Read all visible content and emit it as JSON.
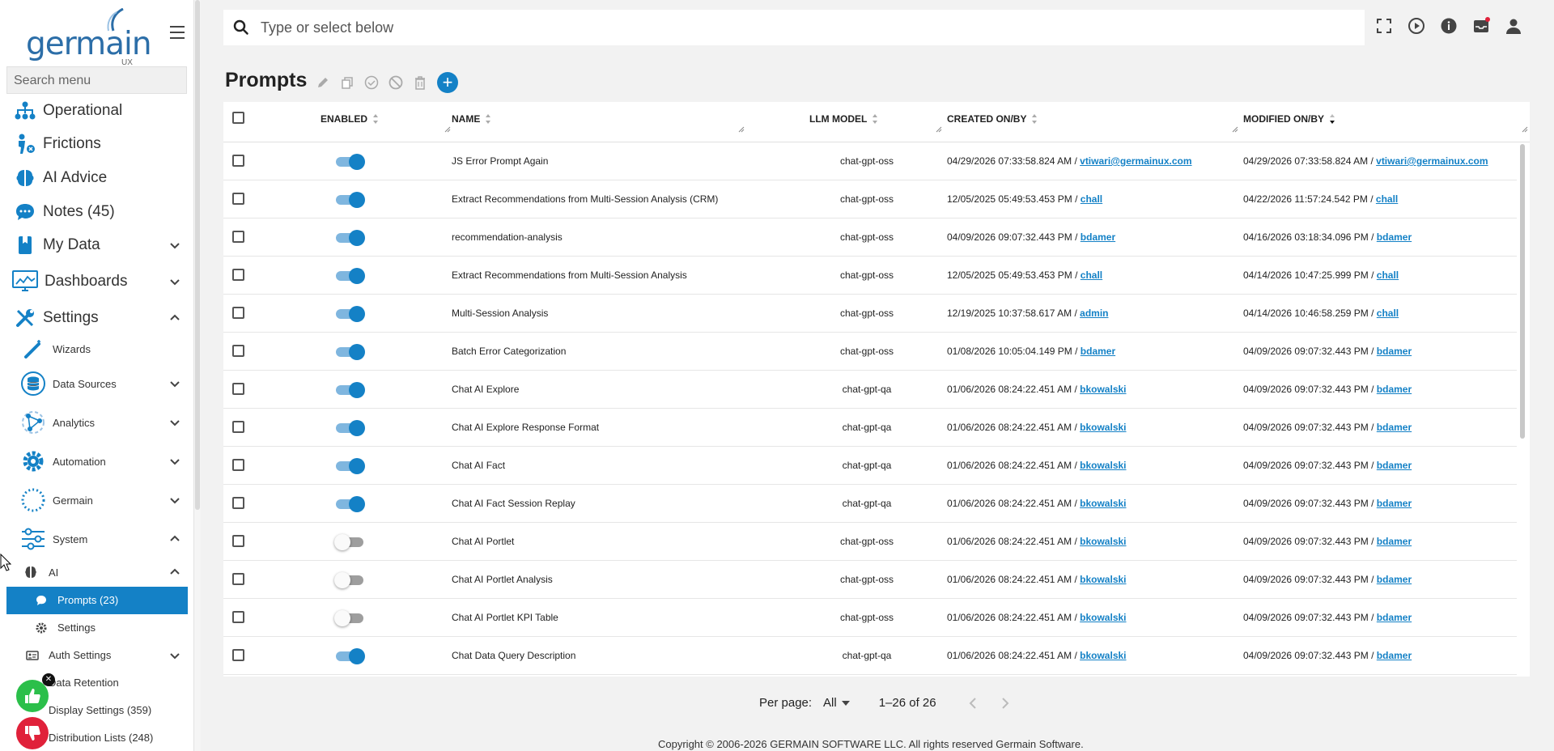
{
  "brand": {
    "name": "germain",
    "sub": "UX",
    "color": "#2c6ea8",
    "accent": "#1481c6"
  },
  "sidebar": {
    "search_placeholder": "Search menu",
    "items": [
      {
        "label": "Operational",
        "icon": "sitemap-icon"
      },
      {
        "label": "Frictions",
        "icon": "person-friction-icon"
      },
      {
        "label": "AI Advice",
        "icon": "brain-icon"
      },
      {
        "label": "Notes (45)",
        "icon": "chat-bubble-icon"
      },
      {
        "label": "My Data",
        "icon": "bookmark-book-icon"
      },
      {
        "label": "Dashboards",
        "icon": "monitor-chart-icon"
      },
      {
        "label": "Settings",
        "icon": "tools-icon"
      }
    ],
    "settings_children": [
      {
        "label": "Wizards",
        "icon": "wand-icon"
      },
      {
        "label": "Data Sources",
        "icon": "database-icon"
      },
      {
        "label": "Analytics",
        "icon": "analytics-icon"
      },
      {
        "label": "Automation",
        "icon": "gear-icon"
      },
      {
        "label": "Germain",
        "icon": "germain-ring-icon"
      },
      {
        "label": "System",
        "icon": "sliders-icon"
      }
    ],
    "system_children": [
      {
        "label": "AI",
        "icon": "brain-small-icon"
      }
    ],
    "ai_children": [
      {
        "label": "Prompts",
        "count": "(23)",
        "icon": "chat-small-icon"
      },
      {
        "label": "Settings",
        "icon": "gear-small-icon"
      }
    ],
    "more_children": [
      {
        "label": "Auth Settings",
        "icon": "id-card-icon"
      },
      {
        "label": "Data Retention",
        "icon": "archive-icon"
      },
      {
        "label": "Display Settings",
        "count": "(359)",
        "icon": "display-icon"
      },
      {
        "label": "Distribution Lists",
        "count": "(248)",
        "icon": "list-icon"
      }
    ]
  },
  "topbar": {
    "search_placeholder": "Type or select below"
  },
  "page": {
    "title": "Prompts"
  },
  "table": {
    "headers": {
      "enabled": "ENABLED",
      "name": "NAME",
      "model": "LLM MODEL",
      "created": "CREATED ON/BY",
      "modified": "MODIFIED ON/BY"
    },
    "rows": [
      {
        "enabled": true,
        "name": "JS Error Prompt Again",
        "model": "chat-gpt-oss",
        "created_on": "04/29/2026 07:33:58.824 AM / ",
        "created_by": "vtiwari@germainux.com",
        "modified_on": "04/29/2026 07:33:58.824 AM / ",
        "modified_by": "vtiwari@germainux.com"
      },
      {
        "enabled": true,
        "name": "Extract Recommendations from Multi-Session Analysis (CRM)",
        "model": "chat-gpt-oss",
        "created_on": "12/05/2025 05:49:53.453 PM / ",
        "created_by": "chall",
        "modified_on": "04/22/2026 11:57:24.542 PM / ",
        "modified_by": "chall"
      },
      {
        "enabled": true,
        "name": "recommendation-analysis",
        "model": "chat-gpt-oss",
        "created_on": "04/09/2026 09:07:32.443 PM / ",
        "created_by": "bdamer",
        "modified_on": "04/16/2026 03:18:34.096 PM / ",
        "modified_by": "bdamer"
      },
      {
        "enabled": true,
        "name": "Extract Recommendations from Multi-Session Analysis",
        "model": "chat-gpt-oss",
        "created_on": "12/05/2025 05:49:53.453 PM / ",
        "created_by": "chall",
        "modified_on": "04/14/2026 10:47:25.999 PM / ",
        "modified_by": "chall"
      },
      {
        "enabled": true,
        "name": "Multi-Session Analysis",
        "model": "chat-gpt-oss",
        "created_on": "12/19/2025 10:37:58.617 AM / ",
        "created_by": "admin",
        "modified_on": "04/14/2026 10:46:58.259 PM / ",
        "modified_by": "chall"
      },
      {
        "enabled": true,
        "name": "Batch Error Categorization",
        "model": "chat-gpt-oss",
        "created_on": "01/08/2026 10:05:04.149 PM / ",
        "created_by": "bdamer",
        "modified_on": "04/09/2026 09:07:32.443 PM / ",
        "modified_by": "bdamer"
      },
      {
        "enabled": true,
        "name": "Chat AI Explore",
        "model": "chat-gpt-qa",
        "created_on": "01/06/2026 08:24:22.451 AM / ",
        "created_by": "bkowalski",
        "modified_on": "04/09/2026 09:07:32.443 PM / ",
        "modified_by": "bdamer"
      },
      {
        "enabled": true,
        "name": "Chat AI Explore Response Format",
        "model": "chat-gpt-qa",
        "created_on": "01/06/2026 08:24:22.451 AM / ",
        "created_by": "bkowalski",
        "modified_on": "04/09/2026 09:07:32.443 PM / ",
        "modified_by": "bdamer"
      },
      {
        "enabled": true,
        "name": "Chat AI Fact",
        "model": "chat-gpt-qa",
        "created_on": "01/06/2026 08:24:22.451 AM / ",
        "created_by": "bkowalski",
        "modified_on": "04/09/2026 09:07:32.443 PM / ",
        "modified_by": "bdamer"
      },
      {
        "enabled": true,
        "name": "Chat AI Fact Session Replay",
        "model": "chat-gpt-qa",
        "created_on": "01/06/2026 08:24:22.451 AM / ",
        "created_by": "bkowalski",
        "modified_on": "04/09/2026 09:07:32.443 PM / ",
        "modified_by": "bdamer"
      },
      {
        "enabled": false,
        "name": "Chat AI Portlet",
        "model": "chat-gpt-oss",
        "created_on": "01/06/2026 08:24:22.451 AM / ",
        "created_by": "bkowalski",
        "modified_on": "04/09/2026 09:07:32.443 PM / ",
        "modified_by": "bdamer"
      },
      {
        "enabled": false,
        "name": "Chat AI Portlet Analysis",
        "model": "chat-gpt-oss",
        "created_on": "01/06/2026 08:24:22.451 AM / ",
        "created_by": "bkowalski",
        "modified_on": "04/09/2026 09:07:32.443 PM / ",
        "modified_by": "bdamer"
      },
      {
        "enabled": false,
        "name": "Chat AI Portlet KPI Table",
        "model": "chat-gpt-oss",
        "created_on": "01/06/2026 08:24:22.451 AM / ",
        "created_by": "bkowalski",
        "modified_on": "04/09/2026 09:07:32.443 PM / ",
        "modified_by": "bdamer"
      },
      {
        "enabled": true,
        "name": "Chat Data Query Description",
        "model": "chat-gpt-qa",
        "created_on": "01/06/2026 08:24:22.451 AM / ",
        "created_by": "bkowalski",
        "modified_on": "04/09/2026 09:07:32.443 PM / ",
        "modified_by": "bdamer"
      }
    ]
  },
  "pager": {
    "per_page_label": "Per page:",
    "per_page_value": "All",
    "range": "1–26 of 26"
  },
  "footer": {
    "text": "Copyright © 2006-2026 GERMAIN SOFTWARE LLC. All rights reserved Germain Software."
  },
  "feedback": {
    "like_color": "#2bbf4a",
    "dislike_color": "#e0213a"
  }
}
